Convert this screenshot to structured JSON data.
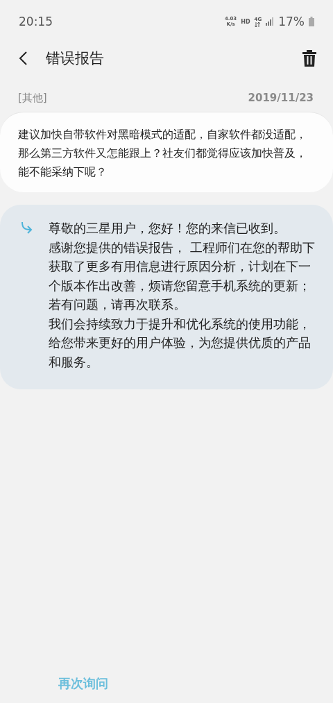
{
  "status_bar": {
    "time": "20:15",
    "speed": "4.03",
    "speed_unit": "K/s",
    "hd": "HD",
    "network": "4G",
    "battery": "17%"
  },
  "header": {
    "title": "错误报告"
  },
  "feedback": {
    "category": "[其他]",
    "date": "2019/11/23",
    "text": "建议加快自带软件对黑暗模式的适配，自家软件都没适配，那么第三方软件又怎能跟上？社友们都觉得应该加快普及，能不能采纳下呢？"
  },
  "reply": {
    "paragraphs": [
      "尊敬的三星用户，您好！您的来信已收到。",
      "感谢您提供的错误报告， 工程师们在您的帮助下获取了更多有用信息进行原因分析，计划在下一个版本作出改善，烦请您留意手机系统的更新；若有问题，请再次联系。",
      "我们会持续致力于提升和优化系统的使用功能，给您带来更好的用户体验，为您提供优质的产品和服务。"
    ]
  },
  "bottom_actions": [
    {
      "label": "再次询问"
    }
  ]
}
